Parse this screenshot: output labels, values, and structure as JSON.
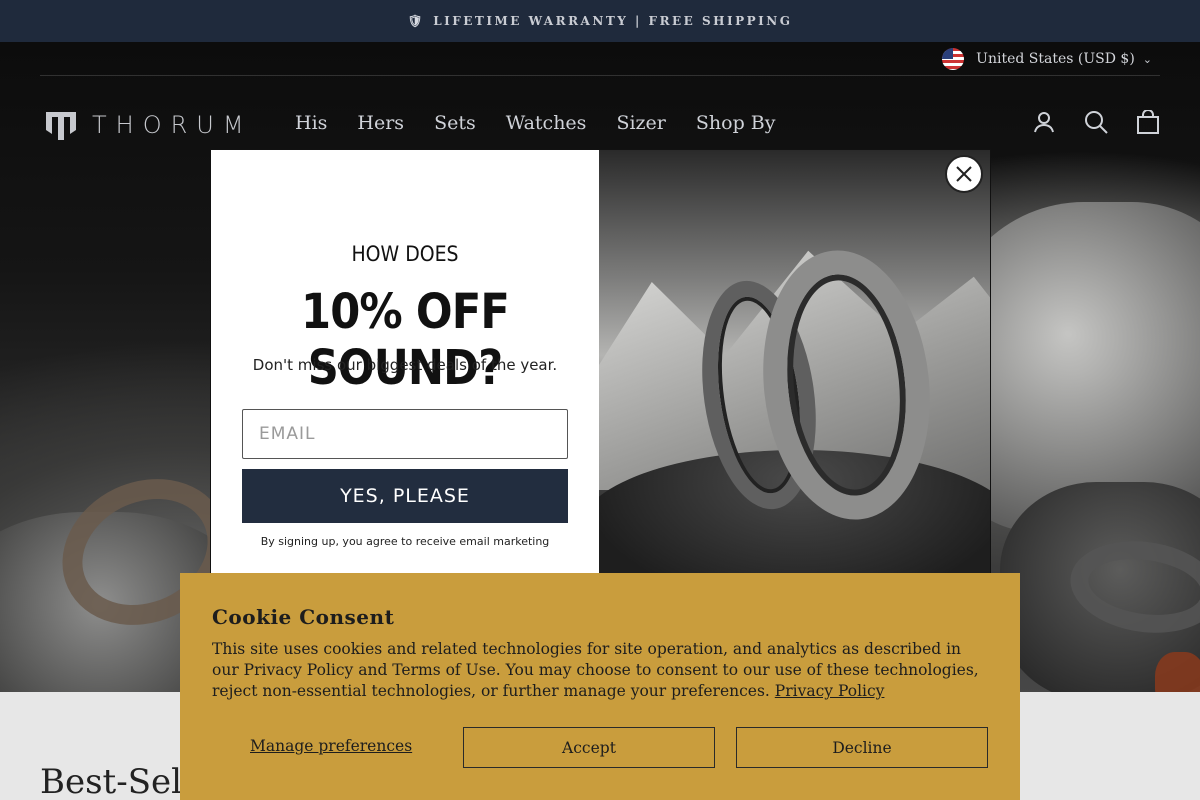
{
  "announcement": {
    "text": "LIFETIME WARRANTY | FREE SHIPPING"
  },
  "country_selector": {
    "label": "United States (USD $)"
  },
  "header": {
    "logo_text": "THORUM",
    "nav": [
      {
        "label": "His"
      },
      {
        "label": "Hers"
      },
      {
        "label": "Sets"
      },
      {
        "label": "Watches"
      },
      {
        "label": "Sizer"
      },
      {
        "label": "Shop By"
      }
    ],
    "icons": [
      "account-icon",
      "search-icon",
      "cart-icon"
    ]
  },
  "popup": {
    "kicker": "HOW DOES",
    "headline": "10% OFF SOUND?",
    "subtext": "Don't miss our biggest deals of the year.",
    "email_placeholder": "EMAIL",
    "cta_label": "YES, PLEASE",
    "legal": "By signing up, you agree to receive email marketing"
  },
  "cookie": {
    "title": "Cookie Consent",
    "body": "This site uses cookies and related technologies for site operation, and analytics as described in our Privacy Policy and Terms of Use. You may choose to consent to our use of these technologies, reject non-essential technologies, or further manage your preferences.",
    "policy_link": "Privacy Policy",
    "manage_label": "Manage preferences",
    "accept_label": "Accept",
    "decline_label": "Decline"
  },
  "section": {
    "title": "Best-Selle"
  },
  "colors": {
    "announcement_bg": "#1f2a3c",
    "cta_bg": "#222d3f",
    "cookie_bg": "#c99d3d"
  }
}
